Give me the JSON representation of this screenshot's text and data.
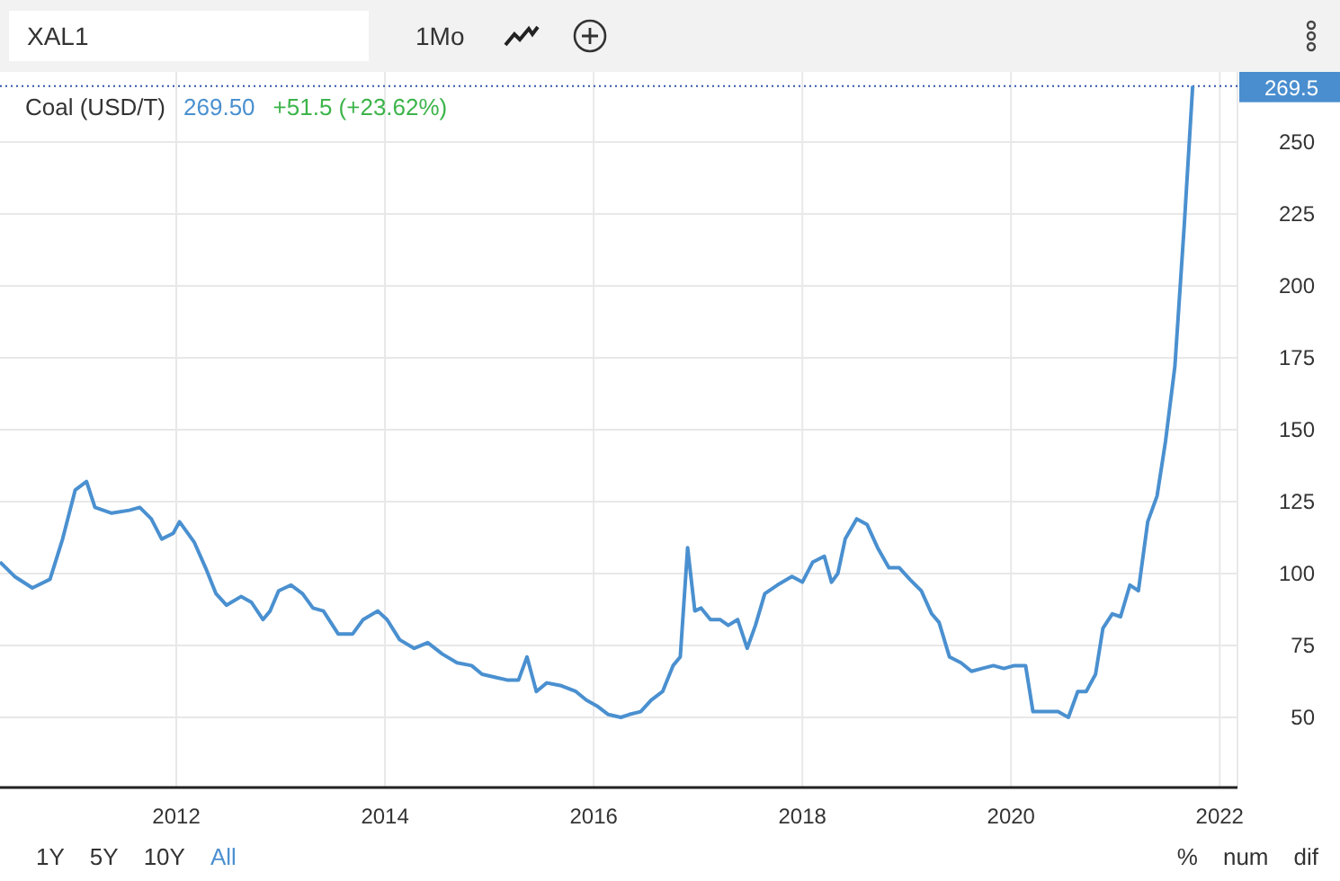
{
  "toolbar": {
    "symbol": "XAL1",
    "interval": "1Mo"
  },
  "legend": {
    "price": "269.50",
    "change": "+51.5 (+23.62%)"
  },
  "price_badge": "269.5",
  "chart_data": {
    "type": "line",
    "grid": true,
    "ref_lines": [
      {
        "axis": "y",
        "value": 269.5,
        "color": "#3355aa"
      }
    ],
    "xlim": [
      2010.31,
      2022.17
    ],
    "ylim": [
      25.6,
      274.4
    ],
    "xticks": [
      2012,
      2014,
      2016,
      2018,
      2020,
      2022
    ],
    "yticks": [
      50,
      75,
      100,
      125,
      150,
      175,
      200,
      225,
      250
    ],
    "x": [
      2010.31,
      2010.45,
      2010.62,
      2010.79,
      2010.91,
      2011.03,
      2011.14,
      2011.22,
      2011.38,
      2011.55,
      2011.65,
      2011.76,
      2011.86,
      2011.97,
      2012.03,
      2012.17,
      2012.28,
      2012.38,
      2012.48,
      2012.62,
      2012.72,
      2012.83,
      2012.9,
      2012.98,
      2013.1,
      2013.21,
      2013.31,
      2013.41,
      2013.55,
      2013.69,
      2013.79,
      2013.93,
      2014.02,
      2014.14,
      2014.28,
      2014.41,
      2014.55,
      2014.69,
      2014.83,
      2014.93,
      2015.05,
      2015.17,
      2015.28,
      2015.36,
      2015.45,
      2015.55,
      2015.69,
      2015.83,
      2015.93,
      2016.03,
      2016.14,
      2016.26,
      2016.34,
      2016.45,
      2016.55,
      2016.66,
      2016.76,
      2016.83,
      2016.9,
      2016.97,
      2017.03,
      2017.12,
      2017.21,
      2017.29,
      2017.38,
      2017.47,
      2017.55,
      2017.64,
      2017.76,
      2017.9,
      2018.0,
      2018.1,
      2018.21,
      2018.28,
      2018.34,
      2018.41,
      2018.52,
      2018.62,
      2018.72,
      2018.83,
      2018.93,
      2019.03,
      2019.14,
      2019.24,
      2019.31,
      2019.41,
      2019.52,
      2019.62,
      2019.72,
      2019.83,
      2019.93,
      2020.03,
      2020.14,
      2020.21,
      2020.31,
      2020.45,
      2020.55,
      2020.64,
      2020.72,
      2020.81,
      2020.88,
      2020.97,
      2021.05,
      2021.14,
      2021.22,
      2021.31,
      2021.4,
      2021.48,
      2021.57,
      2021.66,
      2021.74
    ],
    "series": [
      {
        "name": "Coal (USD/T)",
        "color": "#4a90d0",
        "values": [
          104,
          99,
          95,
          98,
          112,
          129,
          132,
          123,
          121,
          122,
          123,
          119,
          112,
          114,
          118,
          111,
          102,
          93,
          89,
          92,
          90,
          84,
          87,
          94,
          96,
          93,
          88,
          87,
          79,
          79,
          84,
          87,
          84,
          77,
          74,
          76,
          72,
          69,
          68,
          65,
          64,
          63,
          63,
          71,
          59,
          62,
          61,
          59,
          56,
          54,
          51,
          50,
          51,
          52,
          56,
          59,
          68,
          71,
          109,
          87,
          88,
          84,
          84,
          82,
          84,
          74,
          82,
          93,
          96,
          99,
          97,
          104,
          106,
          97,
          100,
          112,
          119,
          117,
          109,
          102,
          102,
          98,
          94,
          86,
          83,
          71,
          69,
          66,
          67,
          68,
          67,
          68,
          68,
          52,
          52,
          52,
          50,
          59,
          59,
          65,
          81,
          86,
          85,
          96,
          94,
          118,
          127,
          146,
          172,
          221,
          269.5
        ]
      }
    ]
  },
  "ranges": [
    {
      "label": "1Y",
      "selected": false
    },
    {
      "label": "5Y",
      "selected": false
    },
    {
      "label": "10Y",
      "selected": false
    },
    {
      "label": "All",
      "selected": true
    }
  ],
  "modes": [
    "%",
    "num",
    "dif"
  ]
}
